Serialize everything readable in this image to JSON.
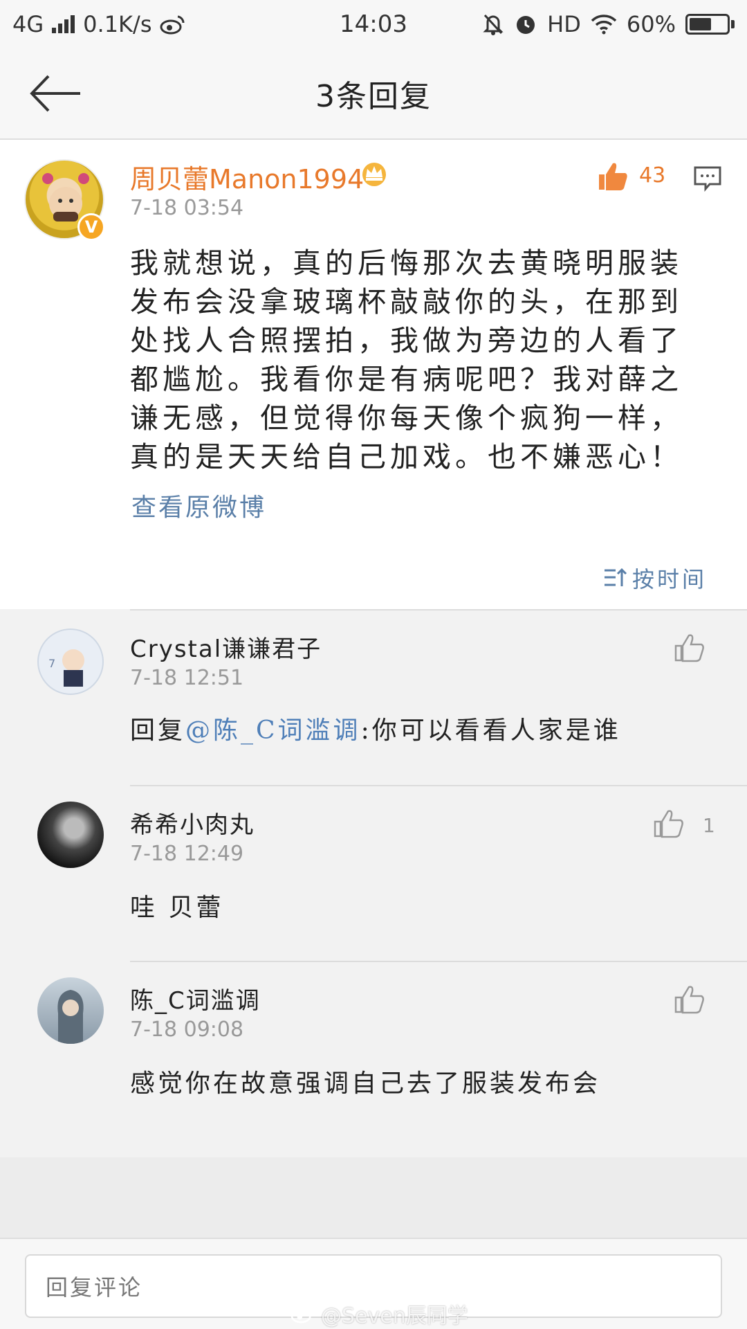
{
  "status_bar": {
    "network": "4G",
    "speed": "0.1K/s",
    "time": "14:03",
    "hd": "HD",
    "battery": "60%",
    "battery_level": 0.6
  },
  "header": {
    "title": "3条回复"
  },
  "main_post": {
    "author": "周贝蕾Manon1994",
    "badge": "V",
    "time": "7-18 03:54",
    "likes": "43",
    "text": "我就想说，真的后悔那次去黄晓明服装发布会没拿玻璃杯敲敲你的头，在那到处找人合照摆拍，我做为旁边的人看了都尴尬。我看你是有病呢吧？我对薛之谦无感，但觉得你每天像个疯狗一样，真的是天天给自己加戏。也不嫌恶心！",
    "view_original": "查看原微博",
    "sort_label": "按时间"
  },
  "comments": [
    {
      "name": "Crystal谦谦君子",
      "time": "7-18 12:51",
      "prefix": "回复",
      "mention": "@陈_C词滥调",
      "text": ":你可以看看人家是谁",
      "likes": ""
    },
    {
      "name": "希希小肉丸",
      "time": "7-18 12:49",
      "prefix": "",
      "mention": "",
      "text": "哇 贝蕾",
      "likes": "1"
    },
    {
      "name": "陈_C词滥调",
      "time": "7-18 09:08",
      "prefix": "",
      "mention": "",
      "text": "感觉你在故意强调自己去了服装发布会",
      "likes": ""
    }
  ],
  "reply_bar": {
    "placeholder": "回复评论"
  },
  "watermark": "@Seven辰同学",
  "colors": {
    "accent_orange": "#e8792b",
    "link_blue": "#5a7fa8"
  }
}
